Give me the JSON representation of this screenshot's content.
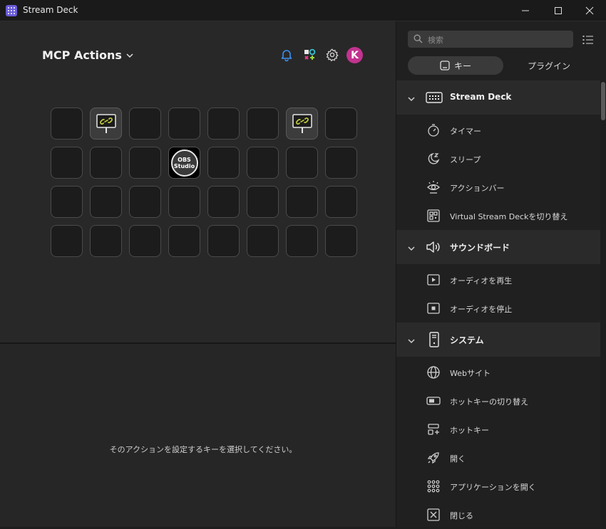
{
  "window": {
    "title": "Stream Deck"
  },
  "profile": {
    "name": "MCP Actions"
  },
  "user": {
    "initial": "K"
  },
  "colors": {
    "accent": "#6a5bd8",
    "avatar": "#c2338f",
    "link_icon": "#c9d23a"
  },
  "deck": {
    "keys": [
      {
        "type": "empty"
      },
      {
        "type": "link",
        "icon": "link-icon"
      },
      {
        "type": "empty"
      },
      {
        "type": "empty"
      },
      {
        "type": "empty"
      },
      {
        "type": "empty"
      },
      {
        "type": "link",
        "icon": "link-icon"
      },
      {
        "type": "empty"
      },
      {
        "type": "empty"
      },
      {
        "type": "empty"
      },
      {
        "type": "empty"
      },
      {
        "type": "obs",
        "text1": "OBS",
        "text2": "Studio"
      },
      {
        "type": "empty"
      },
      {
        "type": "empty"
      },
      {
        "type": "empty"
      },
      {
        "type": "empty"
      },
      {
        "type": "empty"
      },
      {
        "type": "empty"
      },
      {
        "type": "empty"
      },
      {
        "type": "empty"
      },
      {
        "type": "empty"
      },
      {
        "type": "empty"
      },
      {
        "type": "empty"
      },
      {
        "type": "empty"
      },
      {
        "type": "empty"
      },
      {
        "type": "empty"
      },
      {
        "type": "empty"
      },
      {
        "type": "empty"
      },
      {
        "type": "empty"
      },
      {
        "type": "empty"
      },
      {
        "type": "empty"
      },
      {
        "type": "empty"
      }
    ]
  },
  "inspector": {
    "hint": "そのアクションを設定するキーを選択してください。"
  },
  "sidebar": {
    "search_placeholder": "検索",
    "tab_keys": "キー",
    "tab_plugins": "プラグイン",
    "categories": [
      {
        "label": "Stream Deck",
        "icon": "stream-deck-icon",
        "actions": [
          {
            "label": "タイマー",
            "icon": "timer-icon"
          },
          {
            "label": "スリープ",
            "icon": "sleep-icon"
          },
          {
            "label": "アクションバー",
            "icon": "action-bar-icon"
          },
          {
            "label": "Virtual Stream Deckを切り替え",
            "icon": "virtual-deck-icon"
          }
        ]
      },
      {
        "label": "サウンドボード",
        "icon": "speaker-icon",
        "actions": [
          {
            "label": "オーディオを再生",
            "icon": "audio-play-icon"
          },
          {
            "label": "オーディオを停止",
            "icon": "audio-stop-icon"
          }
        ]
      },
      {
        "label": "システム",
        "icon": "system-icon",
        "actions": [
          {
            "label": "Webサイト",
            "icon": "globe-icon"
          },
          {
            "label": "ホットキーの切り替え",
            "icon": "toggle-icon"
          },
          {
            "label": "ホットキー",
            "icon": "hotkey-icon"
          },
          {
            "label": "開く",
            "icon": "rocket-icon"
          },
          {
            "label": "アプリケーションを開く",
            "icon": "app-grid-icon"
          },
          {
            "label": "閉じる",
            "icon": "close-box-icon"
          }
        ]
      }
    ]
  }
}
